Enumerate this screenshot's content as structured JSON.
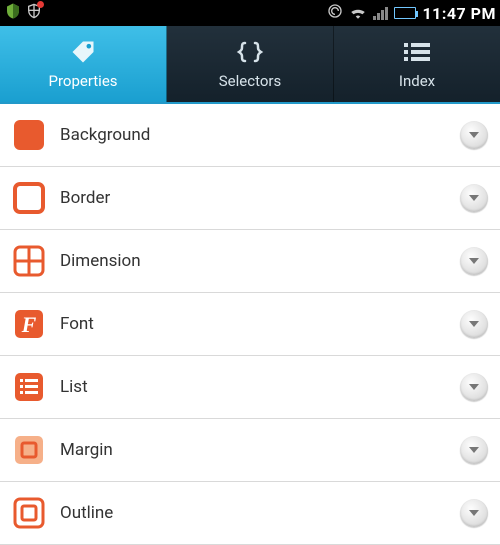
{
  "colors": {
    "accent": "#e85a2e",
    "tab_active": "#2aaad4"
  },
  "status": {
    "time": "11:47 PM"
  },
  "tabs": [
    {
      "id": "properties",
      "label": "Properties",
      "icon": "tag-icon",
      "active": true
    },
    {
      "id": "selectors",
      "label": "Selectors",
      "icon": "braces-icon",
      "active": false
    },
    {
      "id": "index",
      "label": "Index",
      "icon": "list-icon",
      "active": false
    }
  ],
  "rows": [
    {
      "id": "background",
      "label": "Background",
      "icon": "background-icon"
    },
    {
      "id": "border",
      "label": "Border",
      "icon": "border-icon"
    },
    {
      "id": "dimension",
      "label": "Dimension",
      "icon": "dimension-icon"
    },
    {
      "id": "font",
      "label": "Font",
      "icon": "font-icon"
    },
    {
      "id": "list",
      "label": "List",
      "icon": "list-prop-icon"
    },
    {
      "id": "margin",
      "label": "Margin",
      "icon": "margin-icon"
    },
    {
      "id": "outline",
      "label": "Outline",
      "icon": "outline-icon"
    }
  ]
}
